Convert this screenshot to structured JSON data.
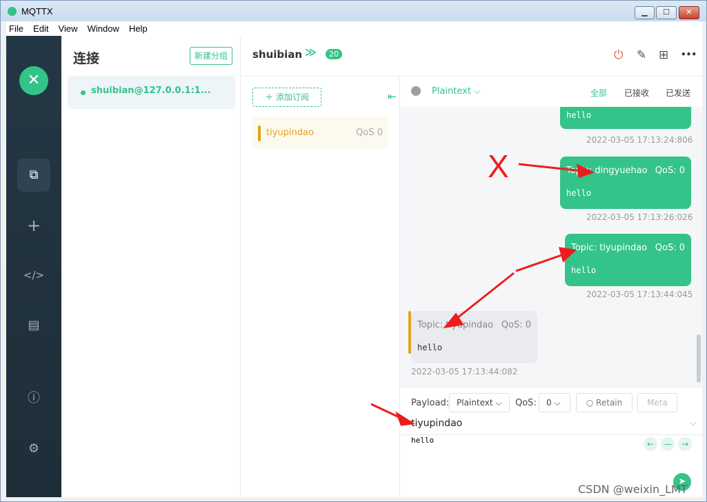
{
  "window": {
    "title": "MQTTX",
    "min_label": "▁",
    "max_label": "☐",
    "close_label": "✕"
  },
  "menubar": [
    "File",
    "Edit",
    "View",
    "Window",
    "Help"
  ],
  "sidenav": {
    "logo_glyph": "✕",
    "items": [
      {
        "icon": "connections-icon",
        "glyph": "⧉",
        "active": true
      },
      {
        "icon": "plus-icon",
        "glyph": "+",
        "active": false
      },
      {
        "icon": "code-icon",
        "glyph": "</>",
        "active": false
      },
      {
        "icon": "log-icon",
        "glyph": "▤",
        "active": false
      },
      {
        "icon": "info-icon",
        "glyph": "ⓘ",
        "active": false
      },
      {
        "icon": "gear-icon",
        "glyph": "⚙",
        "active": false
      }
    ]
  },
  "connections": {
    "title": "连接",
    "new_group_label": "新建分组",
    "items": [
      {
        "name": "shuibian@127.0.0.1:1...",
        "status_color": "#34c388"
      }
    ]
  },
  "topbar": {
    "connection_name": "shuibian",
    "expand_glyph": "≫",
    "message_count": "20",
    "icons": [
      {
        "name": "power-icon",
        "glyph": "⏻",
        "color": "#e4593f"
      },
      {
        "name": "edit-icon",
        "glyph": "✎",
        "color": "#555"
      },
      {
        "name": "new-window-icon",
        "glyph": "⊞",
        "color": "#555"
      },
      {
        "name": "more-icon",
        "glyph": "•••",
        "color": "#333"
      }
    ]
  },
  "subscriptions": {
    "add_label": "＋ 添加订阅",
    "collapse_glyph": "⇤",
    "items": [
      {
        "topic": "tiyupindao",
        "qos": "QoS 0",
        "color": "#e0a519"
      }
    ]
  },
  "messages_header": {
    "format": "Plaintext ⌵",
    "filters": [
      "全部",
      "已接收",
      "已发送"
    ],
    "active_filter": "全部"
  },
  "messages": [
    {
      "direction": "sent",
      "topic": "",
      "qos": "",
      "payload": "hello",
      "time": "2022-03-05 17:13:24:806"
    },
    {
      "direction": "sent",
      "topic": "Topic: dingyuehao",
      "qos": "QoS: 0",
      "payload": "hello",
      "time": "2022-03-05 17:13:26:026"
    },
    {
      "direction": "sent",
      "topic": "Topic: tiyupindao",
      "qos": "QoS: 0",
      "payload": "hello",
      "time": "2022-03-05 17:13:44:045"
    },
    {
      "direction": "received",
      "topic": "Topic: tiyupindao",
      "qos": "QoS: 0",
      "payload": "hello",
      "time": "2022-03-05 17:13:44:082"
    }
  ],
  "composer": {
    "payload_label": "Payload:",
    "payload_format": "Plaintext ⌵",
    "qos_label": "QoS:",
    "qos_value": "0 ⌵",
    "retain_label": "○  Retain",
    "meta_label": "Meta",
    "topic_value": "tiyupindao",
    "topic_chevron": "⌵",
    "payload_value": "hello",
    "nav_back": "←",
    "nav_mid": "—",
    "nav_forward": "→",
    "send_glyph": "➤"
  },
  "annotation_mark": "X",
  "watermark": "CSDN @weixin_LMT",
  "colors": {
    "accent": "#34c388",
    "received": "#e0a519",
    "sidebar": "#243744",
    "arrow": "#ee1c1c"
  }
}
